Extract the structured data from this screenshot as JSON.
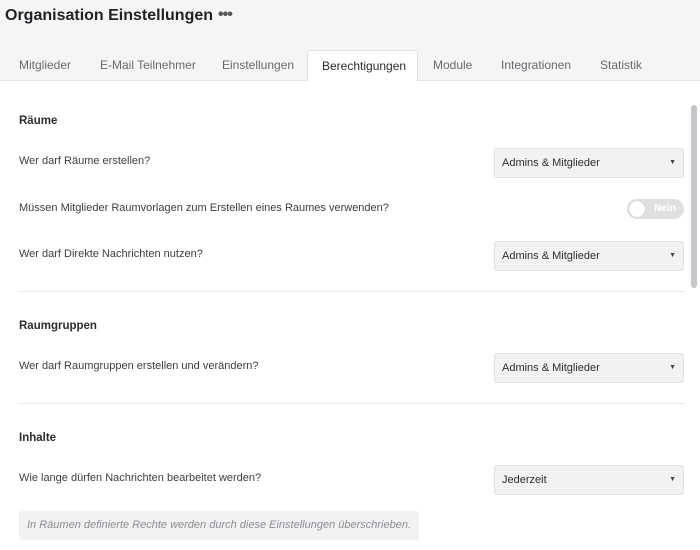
{
  "header": {
    "title": "Organisation Einstellungen",
    "more_label": "•••"
  },
  "tabs": [
    {
      "label": "Mitglieder",
      "active": false
    },
    {
      "label": "E-Mail Teilnehmer",
      "active": false
    },
    {
      "label": "Einstellungen",
      "active": false
    },
    {
      "label": "Berechtigungen",
      "active": true
    },
    {
      "label": "Module",
      "active": false
    },
    {
      "label": "Integrationen",
      "active": false
    },
    {
      "label": "Statistik",
      "active": false
    }
  ],
  "sections": {
    "raeume": {
      "title": "Räume",
      "create_question": "Wer darf Räume erstellen?",
      "create_value": "Admins & Mitglieder",
      "templates_question": "Müssen Mitglieder Raumvorlagen zum Erstellen eines Raumes verwenden?",
      "templates_toggle_label": "Nein",
      "templates_toggle_on": false,
      "dm_question": "Wer darf Direkte Nachrichten nutzen?",
      "dm_value": "Admins & Mitglieder"
    },
    "raumgruppen": {
      "title": "Raumgruppen",
      "edit_question": "Wer darf Raumgruppen erstellen und verändern?",
      "edit_value": "Admins & Mitglieder"
    },
    "inhalte": {
      "title": "Inhalte",
      "edit_question": "Wie lange dürfen Nachrichten bearbeitet werden?",
      "edit_value": "Jederzeit",
      "note": "In Räumen definierte Rechte werden durch diese Einstellungen überschrieben."
    }
  },
  "icons": {
    "caret": "chevron-down-icon",
    "more": "more-horizontal-icon"
  },
  "colors": {
    "active_tab_bg": "#ffffff",
    "toggle_off": "#dfe0e2"
  }
}
